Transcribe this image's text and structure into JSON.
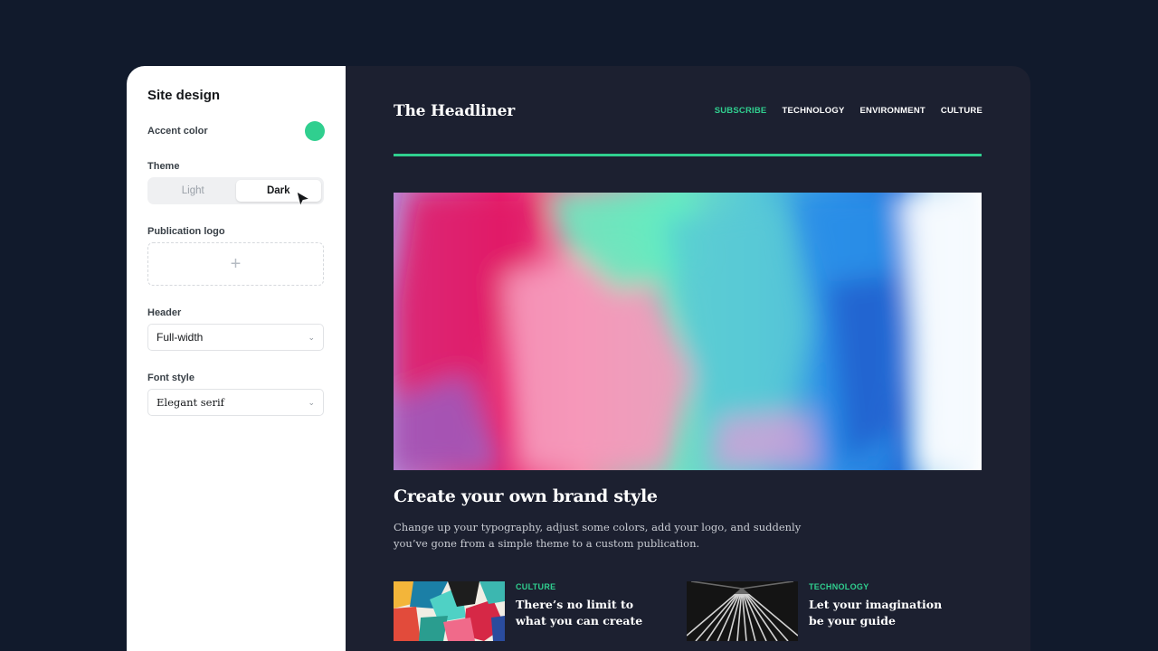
{
  "colors": {
    "accent": "#30cf8f",
    "page_background": "#111a2c",
    "preview_background": "#1c2030",
    "sidebar_background": "#ffffff"
  },
  "sidebar": {
    "title": "Site design",
    "accent_label": "Accent color",
    "theme": {
      "label": "Theme",
      "options": [
        "Light",
        "Dark"
      ],
      "selected": "Dark"
    },
    "logo": {
      "label": "Publication logo",
      "icon": "plus-icon"
    },
    "header": {
      "label": "Header",
      "value": "Full-width"
    },
    "font_style": {
      "label": "Font style",
      "value": "Elegant serif"
    }
  },
  "preview": {
    "publication_name": "The Headliner",
    "nav": [
      "SUBSCRIBE",
      "TECHNOLOGY",
      "ENVIRONMENT",
      "CULTURE"
    ],
    "feature": {
      "title": "Create your own brand style",
      "excerpt": "Change up your typography, adjust some colors, add your logo, and suddenly you’ve gone from a simple theme to a custom publication."
    },
    "cards": [
      {
        "tag": "CULTURE",
        "title": "There’s no limit to what you can create"
      },
      {
        "tag": "TECHNOLOGY",
        "title": "Let your imagination be your guide"
      }
    ]
  }
}
